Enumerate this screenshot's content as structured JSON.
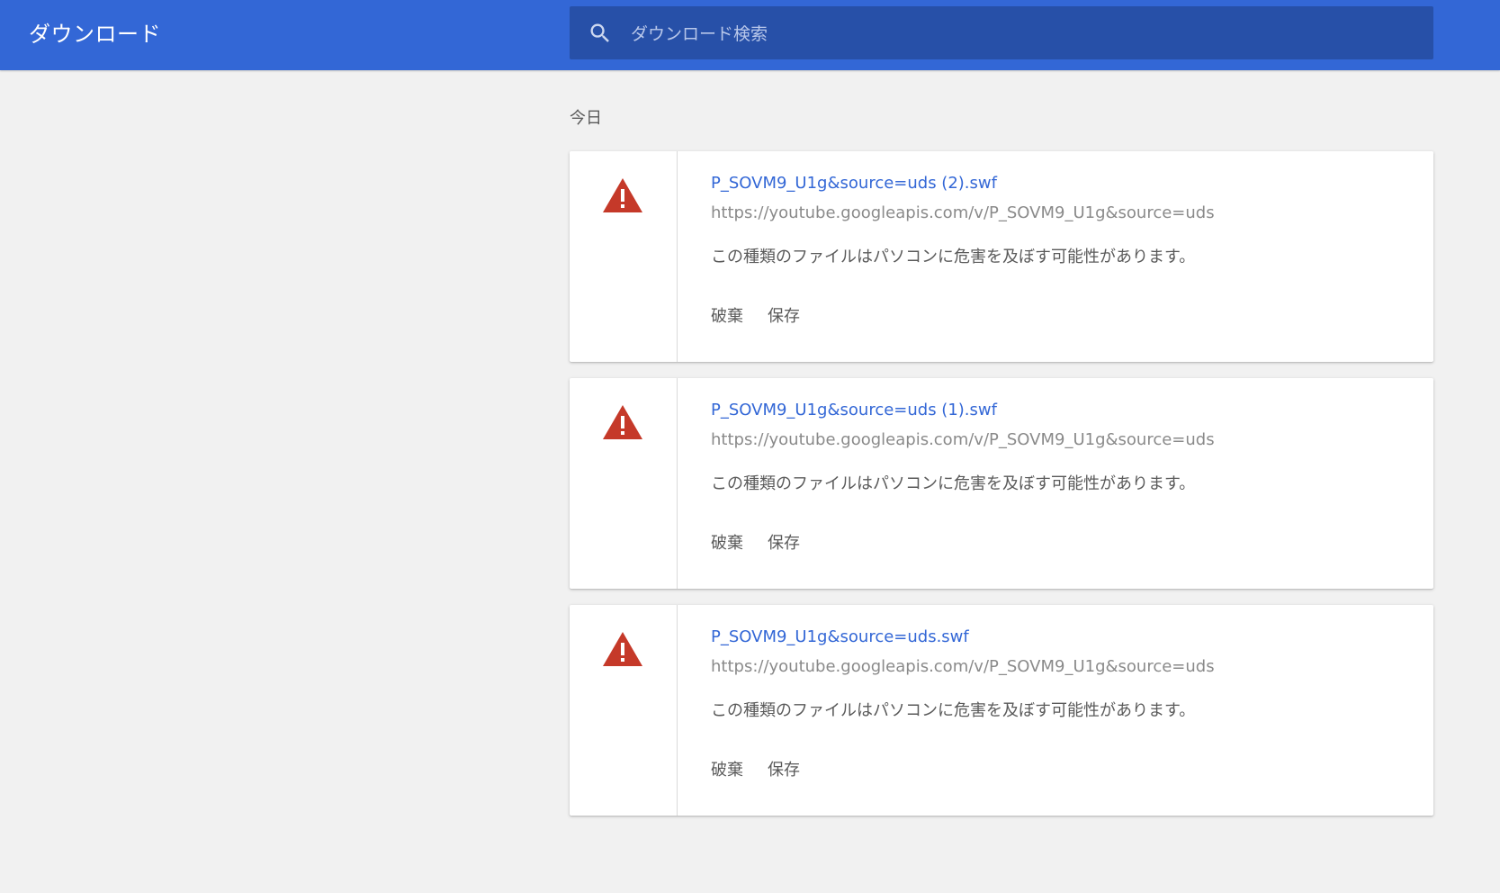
{
  "header": {
    "title": "ダウンロード",
    "search_placeholder": "ダウンロード検索",
    "search_value": "",
    "brand_color": "#3367d6"
  },
  "section": {
    "date_label": "今日"
  },
  "downloads": [
    {
      "file_name": "P_SOVM9_U1g&source=uds (2).swf",
      "url": "https://youtube.googleapis.com/v/P_SOVM9_U1g&source=uds",
      "warning": "この種類のファイルはパソコンに危害を及ぼす可能性があります。",
      "discard_label": "破棄",
      "keep_label": "保存",
      "icon": "warning-icon"
    },
    {
      "file_name": "P_SOVM9_U1g&source=uds (1).swf",
      "url": "https://youtube.googleapis.com/v/P_SOVM9_U1g&source=uds",
      "warning": "この種類のファイルはパソコンに危害を及ぼす可能性があります。",
      "discard_label": "破棄",
      "keep_label": "保存",
      "icon": "warning-icon"
    },
    {
      "file_name": "P_SOVM9_U1g&source=uds.swf",
      "url": "https://youtube.googleapis.com/v/P_SOVM9_U1g&source=uds",
      "warning": "この種類のファイルはパソコンに危害を及ぼす可能性があります。",
      "discard_label": "破棄",
      "keep_label": "保存",
      "icon": "warning-icon"
    }
  ],
  "colors": {
    "warning_red": "#c53929",
    "link_blue": "#3367d6"
  }
}
